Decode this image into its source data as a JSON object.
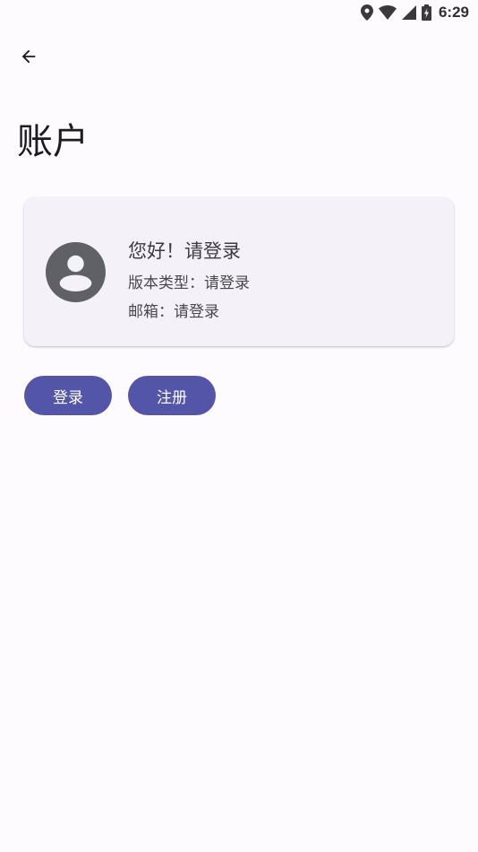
{
  "status_bar": {
    "time": "6:29",
    "icons": [
      "location-icon",
      "wifi-icon",
      "signal-icon",
      "battery-charging-icon"
    ]
  },
  "header": {
    "back_icon": "arrow-left-icon",
    "title": "账户"
  },
  "account_card": {
    "avatar_icon": "account-circle-icon",
    "greeting": "您好！请登录",
    "edition": "版本类型：请登录",
    "email": "邮箱：请登录"
  },
  "actions": {
    "login_label": "登录",
    "register_label": "注册"
  },
  "colors": {
    "background": "#fefbff",
    "card": "#f4f2f8",
    "primary": "#5355a9",
    "avatar": "#5f6166"
  }
}
